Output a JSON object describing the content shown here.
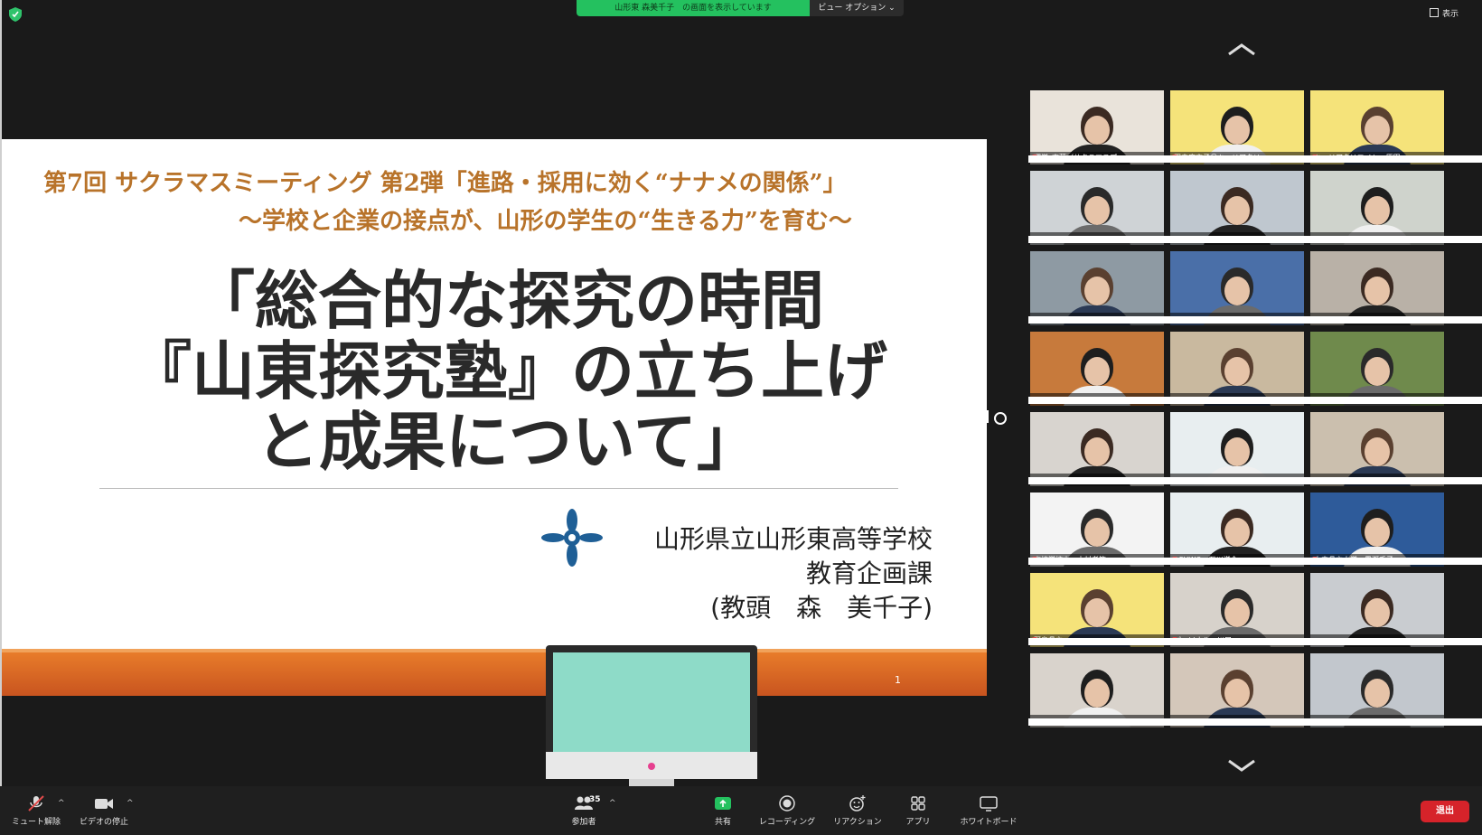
{
  "top_bar": {
    "share_banner": "山形東 森美千子　の画面を表示しています",
    "view_options": "ビュー オプション ⌄",
    "view_button": "表示"
  },
  "slide": {
    "subtitle_line1": "第7回 サクラマスミーティング 第2弾「進路・採用に効く“ナナメの関係”」",
    "subtitle_line2": "～学校と企業の接点が、山形の学生の“生きる力”を育む～",
    "title_lines": [
      "「総合的な探究の時間",
      "『山東探究塾』の立ち上げ",
      "と成果について」"
    ],
    "school": "山形県立山形東高等学校",
    "department": "教育企画課",
    "presenter": "(教頭　森　美千子)",
    "page_number": "1",
    "colors": {
      "subtitle": "#b8732a",
      "footer": "#e87c2a",
      "logo": "#1f5f96"
    }
  },
  "gallery": {
    "tiles": [
      {
        "name": "運営_齋藤（サクラマスプ…",
        "bg": "#e9e3da",
        "speaking": false
      },
      {
        "name": "田中麻衣子＠キャリアクリ…",
        "bg": "#f5e37a",
        "speaking": false
      },
      {
        "name": "キャリアクリエイト　原田",
        "bg": "#f5e37a",
        "speaking": false
      },
      {
        "name": "",
        "bg": "#cfd3d6",
        "speaking": false
      },
      {
        "name": "",
        "bg": "#bfc7cf",
        "speaking": false
      },
      {
        "name": "",
        "bg": "#cfd3cc",
        "speaking": true
      },
      {
        "name": "",
        "bg": "#8e9aa3",
        "speaking": false
      },
      {
        "name": "",
        "bg": "#4a6fa8",
        "speaking": false
      },
      {
        "name": "",
        "bg": "#b9b1a7",
        "speaking": false
      },
      {
        "name": "",
        "bg": "#c77a3c",
        "speaking": false
      },
      {
        "name": "",
        "bg": "#c9b99f",
        "speaking": false
      },
      {
        "name": "",
        "bg": "#6f8a4c",
        "speaking": false
      },
      {
        "name": "",
        "bg": "#d8d4cf",
        "speaking": false
      },
      {
        "name": "",
        "bg": "#e8eef0",
        "speaking": false
      },
      {
        "name": "",
        "bg": "#cbbfae",
        "speaking": false
      },
      {
        "name": "高校学校山　木村者等",
        "bg": "#f3f3f3",
        "speaking": false
      },
      {
        "name": "ASUWO　石川洋介",
        "bg": "#e8eef0",
        "speaking": false
      },
      {
        "name": "山内県立大学　黒瀬千子",
        "bg": "#2e5b9a",
        "speaking": false
      },
      {
        "name": "野鳥県立　",
        "bg": "#f5e37a",
        "speaking": false
      },
      {
        "name": "パーソナル　川口",
        "bg": "#d7d2cb",
        "speaking": false
      },
      {
        "name": "",
        "bg": "#c9ccd0",
        "speaking": false
      },
      {
        "name": "",
        "bg": "#d9d3cc",
        "speaking": false
      },
      {
        "name": "",
        "bg": "#d4c7ba",
        "speaking": false
      },
      {
        "name": "",
        "bg": "#c2c7cd",
        "speaking": false
      }
    ]
  },
  "toolbar": {
    "mute": "ミュート解除",
    "video": "ビデオの停止",
    "participants": "参加者",
    "participant_count": "35",
    "share": "共有",
    "record": "レコーディング",
    "reactions": "リアクション",
    "apps": "アプリ",
    "whiteboard": "ホワイトボード",
    "end": "退出"
  }
}
